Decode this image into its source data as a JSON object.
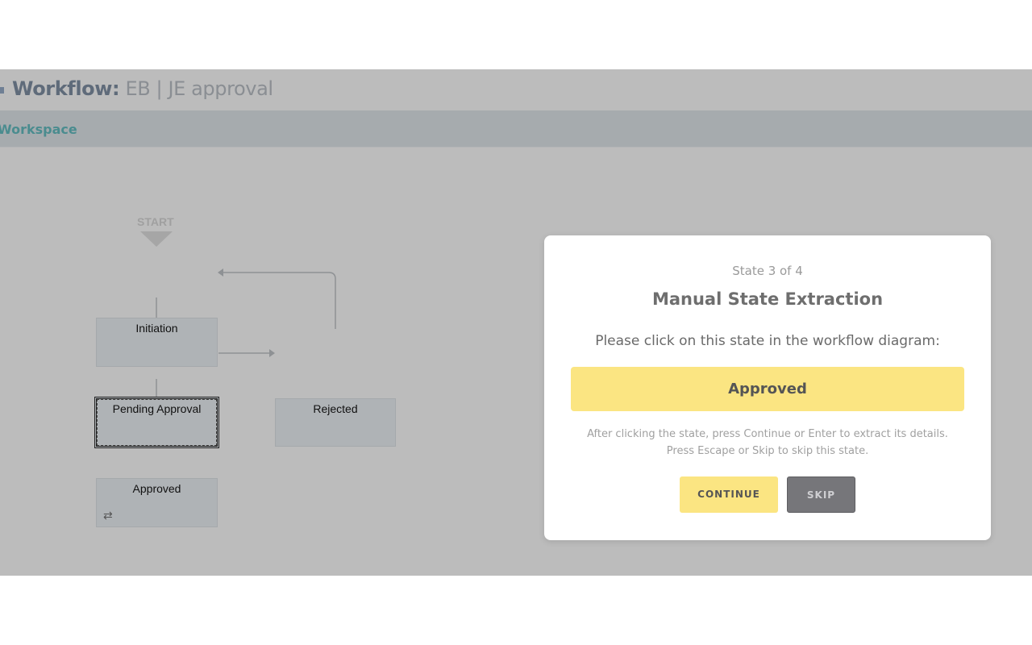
{
  "header": {
    "title_label": "Workflow:",
    "title_value": "EB | JE approval"
  },
  "tabs": {
    "active": "Workspace"
  },
  "diagram": {
    "start_label": "START",
    "nodes": {
      "initiation": "Initiation",
      "pending_approval": "Pending Approval",
      "rejected": "Rejected",
      "approved": "Approved"
    },
    "loop_icon": "loop-arrows-icon"
  },
  "modal": {
    "step": "State 3 of 4",
    "title": "Manual State Extraction",
    "prompt": "Please click on this state in the workflow diagram:",
    "target_state": "Approved",
    "hint": "After clicking the state, press Continue or Enter to extract its details. Press Escape or Skip to skip this state.",
    "continue_label": "CONTINUE",
    "skip_label": "SKIP"
  },
  "colors": {
    "overlay": "#bcbcbc",
    "accent_yellow": "#fbe582",
    "tab_text": "#4a8c8f",
    "skip_button": "#76767a"
  }
}
